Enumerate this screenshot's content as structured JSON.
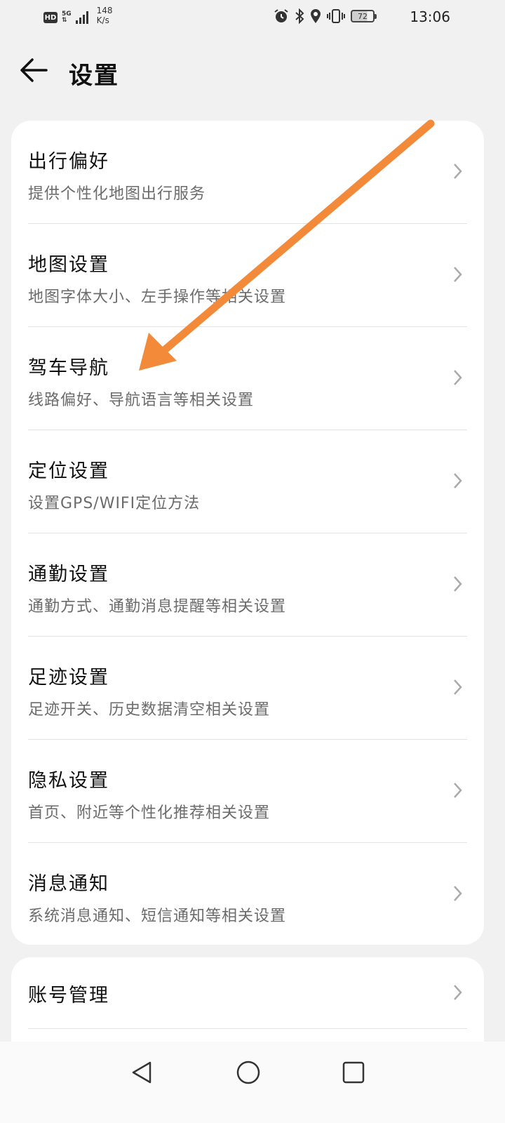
{
  "status_bar": {
    "hd": "HD",
    "network": "5G",
    "speed_value": "148",
    "speed_unit": "K/s",
    "battery": "72",
    "time": "13:06"
  },
  "header": {
    "title": "设置"
  },
  "settings": {
    "items": [
      {
        "title": "出行偏好",
        "subtitle": "提供个性化地图出行服务"
      },
      {
        "title": "地图设置",
        "subtitle": "地图字体大小、左手操作等相关设置"
      },
      {
        "title": "驾车导航",
        "subtitle": "线路偏好、导航语言等相关设置"
      },
      {
        "title": "定位设置",
        "subtitle": "设置GPS/WIFI定位方法"
      },
      {
        "title": "通勤设置",
        "subtitle": "通勤方式、通勤消息提醒等相关设置"
      },
      {
        "title": "足迹设置",
        "subtitle": "足迹开关、历史数据清空相关设置"
      },
      {
        "title": "隐私设置",
        "subtitle": "首页、附近等个性化推荐相关设置"
      },
      {
        "title": "消息通知",
        "subtitle": "系统消息通知、短信通知等相关设置"
      }
    ]
  },
  "account": {
    "title": "账号管理"
  },
  "colors": {
    "annotation_arrow": "#f28a3a",
    "background": "#f1f1f1",
    "card": "#ffffff"
  }
}
